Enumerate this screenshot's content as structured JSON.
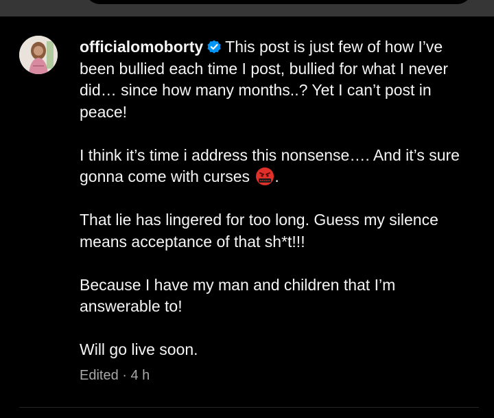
{
  "post": {
    "username": "officialomoborty",
    "caption_paragraphs": [
      "This post is just few of how I’ve been bullied each time I post, bullied for what I never did… since how many months..? Yet I can’t post in peace!",
      "I think it’s time i address this nonsense…. And it’s sure gonna come with curses",
      "That lie has lingered for too long. Guess my silence means acceptance of that sh*t!!!",
      "Because I have my man and children that I’m answerable to!",
      "Will go live soon."
    ],
    "paragraph_2_suffix": ".",
    "edited_label": "Edited",
    "separator": " · ",
    "timestamp": "4 h",
    "icons": {
      "verified": "verified-badge-icon",
      "emoji": "swearing-face-emoji-icon"
    },
    "colors": {
      "background": "#000000",
      "text": "#f5f5f5",
      "meta_text": "#a8a8a8",
      "verified_blue": "#0095f6",
      "emoji_red": "#e0302a"
    }
  }
}
